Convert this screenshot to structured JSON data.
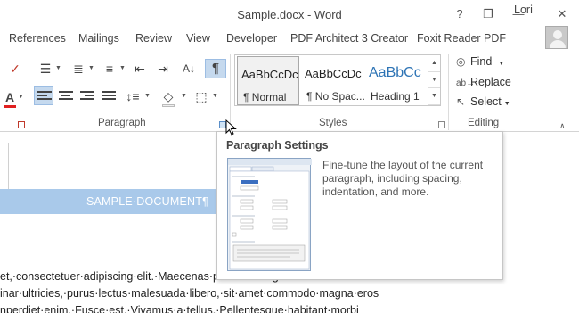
{
  "window": {
    "title": "Sample.docx - Word",
    "controls": [
      "?",
      "❐",
      "—",
      "✕"
    ]
  },
  "menu": {
    "items": [
      "References",
      "Mailings",
      "Review",
      "View",
      "Developer",
      "PDF Architect 3 Creator",
      "Foxit Reader PDF"
    ],
    "user": "Lori"
  },
  "ribbon": {
    "paragraph_label": "Paragraph",
    "styles_label": "Styles",
    "editing_label": "Editing",
    "styles": [
      {
        "sample": "AaBbCcDc",
        "name": "¶ Normal"
      },
      {
        "sample": "AaBbCcDc",
        "name": "¶ No Spac..."
      },
      {
        "sample": "AaBbCc",
        "name": "Heading 1"
      }
    ],
    "editing": {
      "find": "Find",
      "replace": "Replace",
      "select": "Select"
    },
    "colors": {
      "heading_style": "#2e74b5",
      "selected": "#c5d9ee"
    }
  },
  "tooltip": {
    "title": "Paragraph Settings",
    "description": "Fine-tune the layout of the current paragraph, including spacing, indentation, and more."
  },
  "document": {
    "heading": "SAMPLE·DOCUMENT¶",
    "lines": [
      "et,·consectetuer·adipiscing·elit.·Maecenas·porttitor·congue·massa.·Fusce",
      "inar·ultricies,·purus·lectus·malesuada·libero,·sit·amet·commodo·magna·eros",
      "nperdiet·enim.·Fusce·est.·Vivamus·a·tellus.·Pellentesque·habitant·morbi"
    ]
  }
}
